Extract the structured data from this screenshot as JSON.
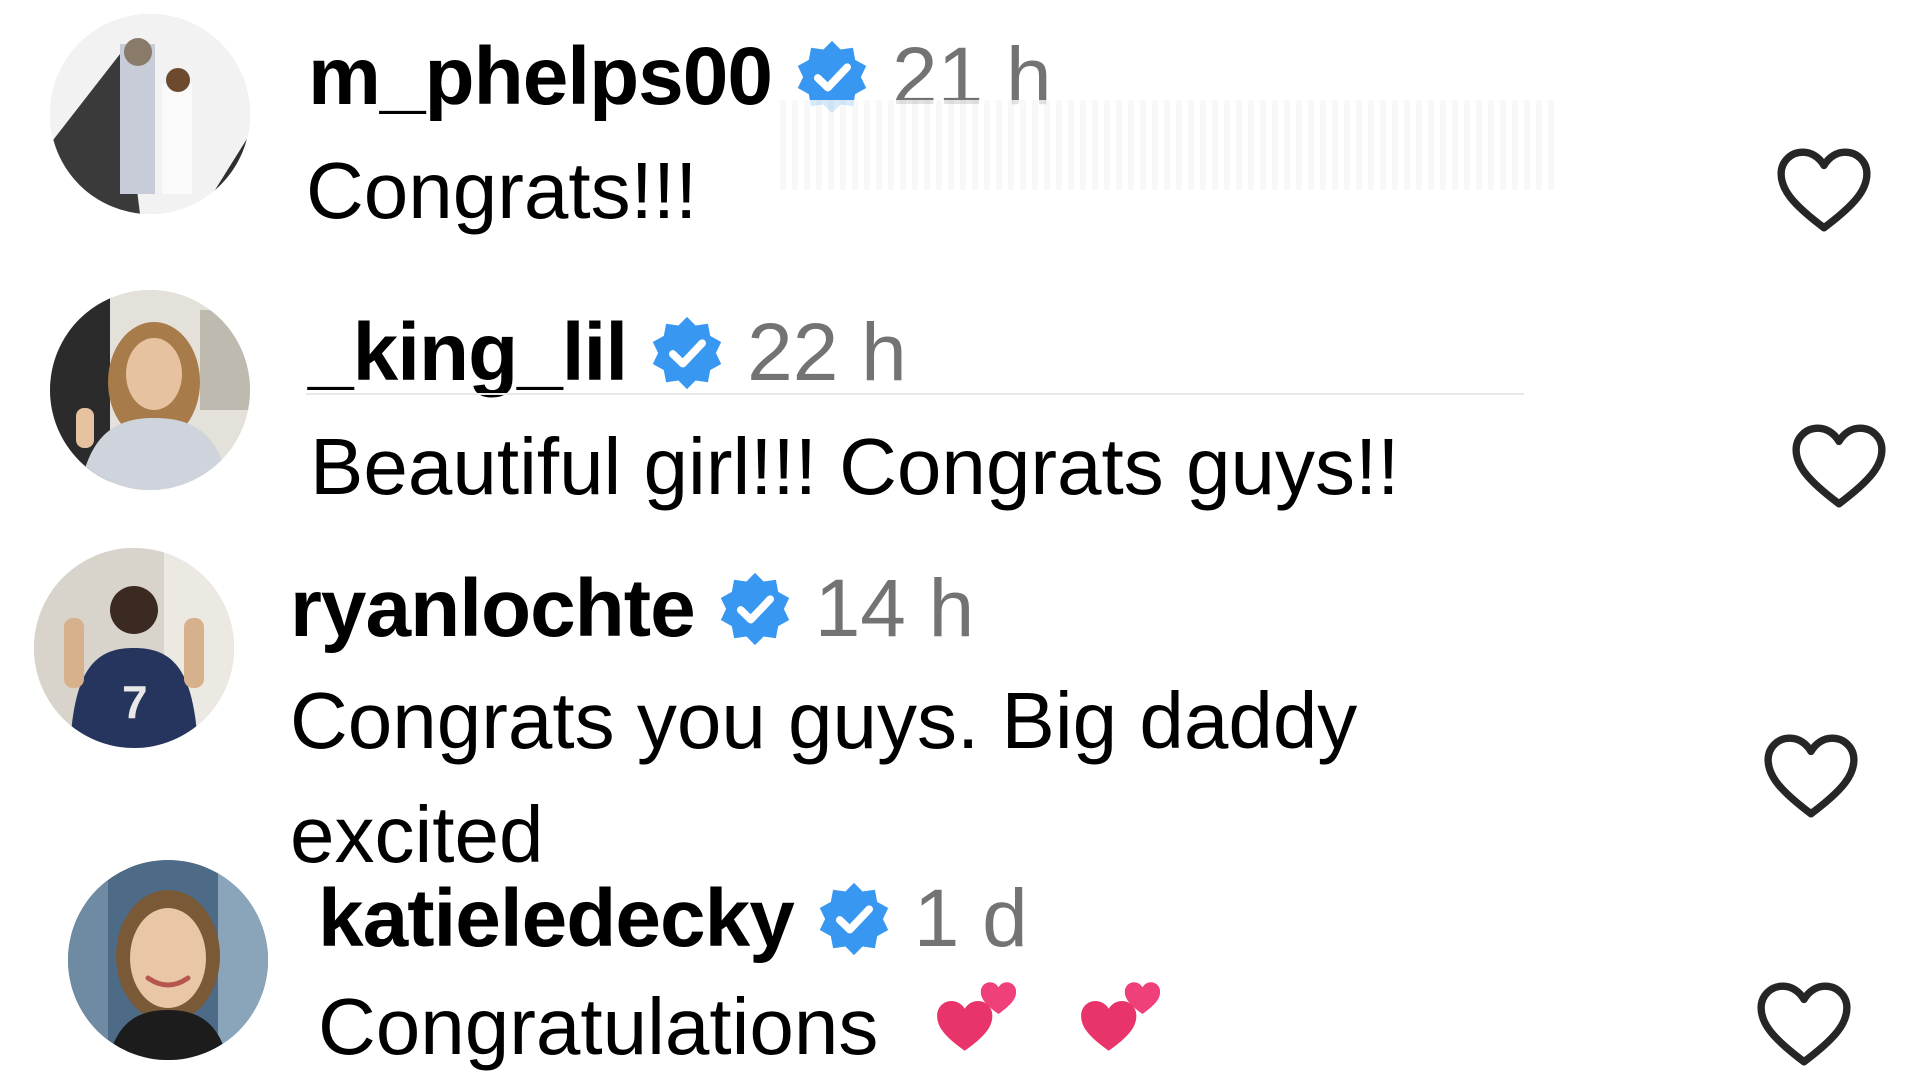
{
  "colors": {
    "verified_badge": "#3897f0",
    "timestamp": "#737373",
    "text": "#000000",
    "like_outline": "#262626",
    "emoji_heart": "#e8336b"
  },
  "icons": {
    "verified": "verified-badge-icon",
    "like": "heart-outline-icon",
    "emoji": "two-hearts-emoji-icon"
  },
  "comments": [
    {
      "username": "m_phelps00",
      "verified": true,
      "timestamp": "21 h",
      "text": "Congrats!!!"
    },
    {
      "username": "_king_lil",
      "verified": true,
      "timestamp": "22 h",
      "text": "Beautiful girl!!! Congrats guys!!"
    },
    {
      "username": "ryanlochte",
      "verified": true,
      "timestamp": "14 h",
      "text": "Congrats you guys. Big daddy excited"
    },
    {
      "username": "katieledecky",
      "verified": true,
      "timestamp": "1 d",
      "text": "Congratulations",
      "emoji": "💕 💕"
    }
  ]
}
